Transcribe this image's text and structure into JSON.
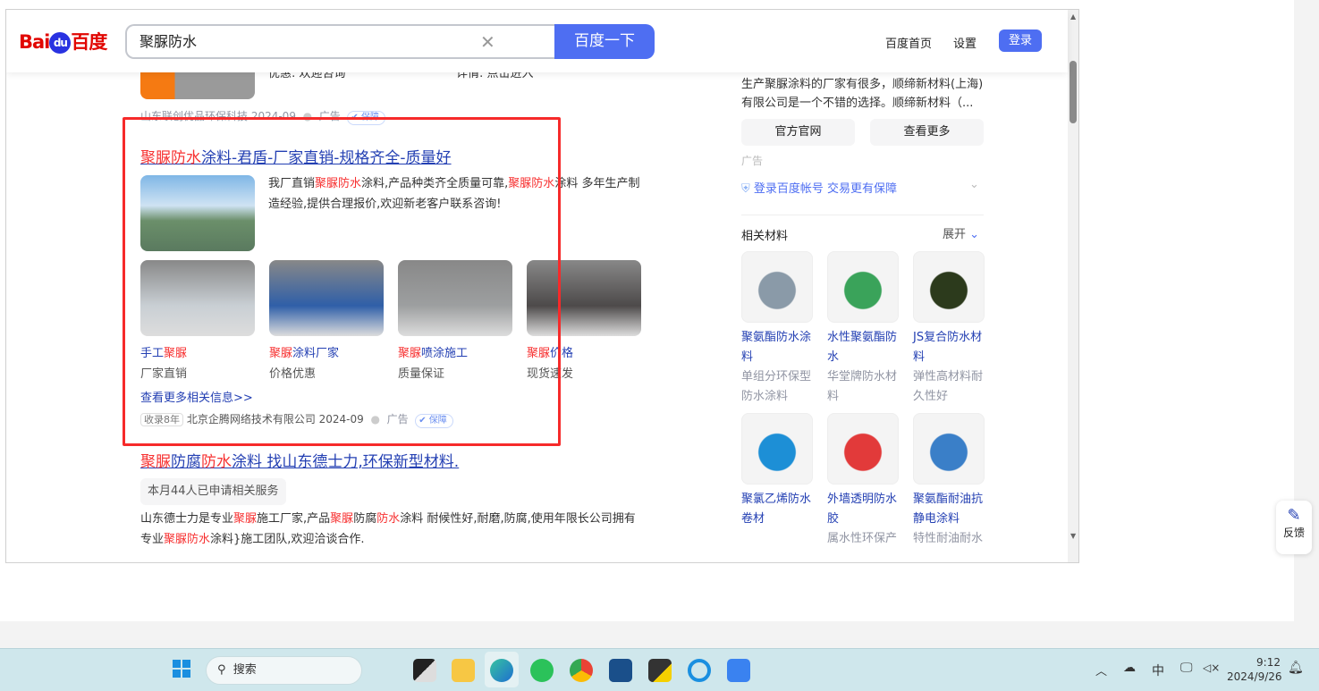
{
  "header": {
    "logo_text": "Bai",
    "logo_du": "du",
    "logo_cn": "百度",
    "query": "聚脲防水",
    "search_button": "百度一下",
    "home_link": "百度首页",
    "settings_link": "设置",
    "login_button": "登录"
  },
  "prev_result": {
    "snippet_left": "优惠: 欢迎咨询",
    "snippet_right": "详情: 点击进入",
    "source": "山东联创优品环保科技 2024-09",
    "ad": "广告",
    "guarantee": "保障"
  },
  "ad_result": {
    "title": [
      [
        "聚脲防水",
        1
      ],
      [
        "涂料-君盾-厂家直销-规格齐全-质量好",
        0
      ]
    ],
    "desc": [
      [
        "我厂直销",
        0
      ],
      [
        "聚脲防水",
        1
      ],
      [
        "涂料,产品种类齐全质量可靠,",
        0
      ],
      [
        "聚脲防水",
        1
      ],
      [
        "涂料 多年生产制造经验,提供合理报价,欢迎新老客户联系咨询!",
        0
      ]
    ],
    "items": [
      {
        "title": [
          [
            "手工",
            0
          ],
          [
            "聚脲",
            1
          ]
        ],
        "sub": "厂家直销"
      },
      {
        "title": [
          [
            "聚脲",
            1
          ],
          [
            "涂料厂家",
            0
          ]
        ],
        "sub": "价格优惠"
      },
      {
        "title": [
          [
            "聚脲",
            1
          ],
          [
            "喷涂施工",
            0
          ]
        ],
        "sub": "质量保证"
      },
      {
        "title": [
          [
            "聚脲",
            1
          ],
          [
            "价格",
            0
          ]
        ],
        "sub": "现货速发"
      }
    ],
    "more_link": "查看更多相关信息>>",
    "age_badge": "收录8年",
    "source": "北京企腾网络技术有限公司 2024-09",
    "ad": "广告",
    "guarantee": "保障"
  },
  "next_result": {
    "title": [
      [
        "聚脲",
        1
      ],
      [
        "防腐",
        0
      ],
      [
        "防水",
        1
      ],
      [
        "涂料 找山东德士力,环保新型材料.",
        0
      ]
    ],
    "tag": "本月44人已申请相关服务",
    "desc": [
      [
        "山东德士力是专业",
        0
      ],
      [
        "聚脲",
        1
      ],
      [
        "施工厂家,产品",
        0
      ],
      [
        "聚脲",
        1
      ],
      [
        "防腐",
        0
      ],
      [
        "防水",
        1
      ],
      [
        "涂料 耐候性好,耐磨,防腐,使用年限长公司拥有专业",
        0
      ],
      [
        "聚脲防水",
        1
      ],
      [
        "涂料}施工团队,欢迎洽谈合作.",
        0
      ]
    ]
  },
  "sidebar": {
    "answer": "生产聚脲涂料的厂家有很多，顺缔新材料(上海)有限公司是一个不错的选择。顺缔新材料（...",
    "btn_official": "官方官网",
    "btn_more": "查看更多",
    "ad": "广告",
    "login_tip": "登录百度帐号 交易更有保障",
    "related_title": "相关材料",
    "expand": "展开",
    "cards": [
      {
        "title": "聚氨酯防水涂料",
        "sub": "单组分环保型防水涂料",
        "color": "#8a9aa8"
      },
      {
        "title": "水性聚氨酯防水",
        "sub": "华堂牌防水材料",
        "color": "#3aa35a"
      },
      {
        "title": "JS复合防水材料",
        "sub": "弹性高材料耐久性好",
        "color": "#2c3a1c"
      },
      {
        "title": "聚氯乙烯防水卷材",
        "sub": "",
        "color": "#1d8fd6"
      },
      {
        "title": "外墙透明防水胶",
        "sub": "属水性环保产",
        "color": "#e23a3a"
      },
      {
        "title": "聚氨酯耐油抗静电涂料",
        "sub": "特性耐油耐水",
        "color": "#3a7fc8"
      }
    ]
  },
  "feedback": "反馈",
  "taskbar": {
    "search": "搜索",
    "time": "9:12",
    "date": "2024/9/26",
    "ime": "中"
  }
}
